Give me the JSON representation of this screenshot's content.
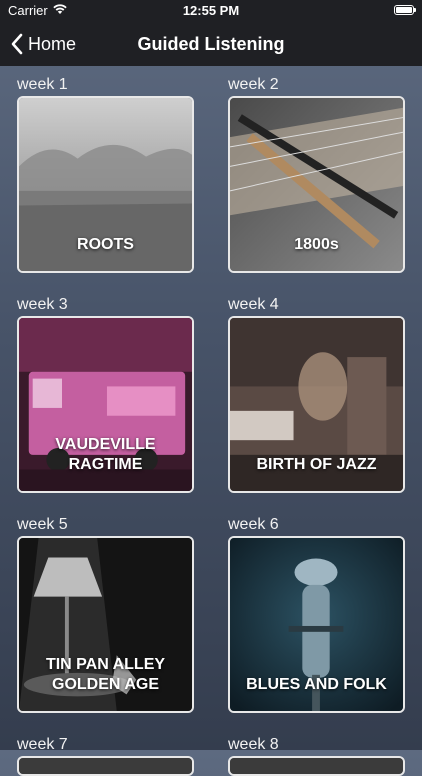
{
  "status_bar": {
    "carrier": "Carrier",
    "time": "12:55 PM"
  },
  "nav": {
    "back_label": "Home",
    "title": "Guided Listening"
  },
  "weeks": [
    {
      "label": "week 1",
      "title": "ROOTS"
    },
    {
      "label": "week 2",
      "title": "1800s"
    },
    {
      "label": "week 3",
      "title": "VAUDEVILLE\nRAGTIME"
    },
    {
      "label": "week 4",
      "title": "BIRTH OF JAZZ"
    },
    {
      "label": "week 5",
      "title": "TIN PAN ALLEY\nGOLDEN AGE"
    },
    {
      "label": "week 6",
      "title": "BLUES AND FOLK"
    },
    {
      "label": "week 7",
      "title": ""
    },
    {
      "label": "week 8",
      "title": ""
    }
  ]
}
